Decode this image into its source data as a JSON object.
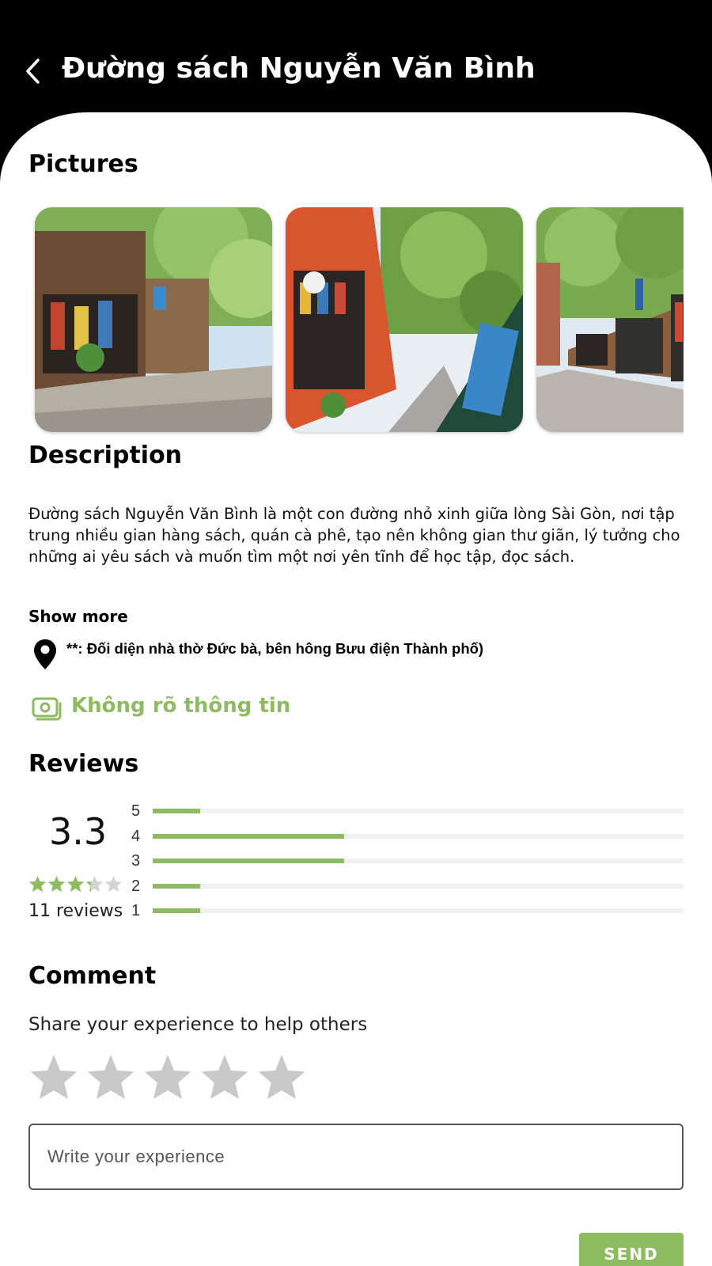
{
  "header": {
    "title": "Đường sách Nguyễn Văn Bình",
    "back_icon": "chevron-left-icon"
  },
  "pictures": {
    "title": "Pictures"
  },
  "description": {
    "title": "Description",
    "text": "Đường sách Nguyễn Văn Bình là một con đường nhỏ xinh giữa lòng Sài Gòn, nơi tập trung nhiều gian hàng sách, quán cà phê, tạo nên không gian thư giãn, lý tưởng cho những ai yêu sách và muốn tìm một nơi yên tĩnh để học tập, đọc sách.",
    "show_more": "Show more"
  },
  "location": {
    "icon": "map-pin-icon",
    "address": "**: Đối diện nhà thờ Đức bà, bên hông Bưu điện Thành phố)"
  },
  "price": {
    "icon": "money-icon",
    "text": "Không rõ thông tin",
    "color": "#8dbb5f"
  },
  "reviews": {
    "title": "Reviews",
    "average": "3.3",
    "count_text": "11 reviews",
    "distribution": [
      {
        "label": "5",
        "fraction": 0.09
      },
      {
        "label": "4",
        "fraction": 0.36
      },
      {
        "label": "3",
        "fraction": 0.36
      },
      {
        "label": "2",
        "fraction": 0.09
      },
      {
        "label": "1",
        "fraction": 0.09
      }
    ]
  },
  "comment": {
    "title": "Comment",
    "subtitle": "Share your experience to help others",
    "placeholder": "Write your experience",
    "send_label": "SEND"
  }
}
